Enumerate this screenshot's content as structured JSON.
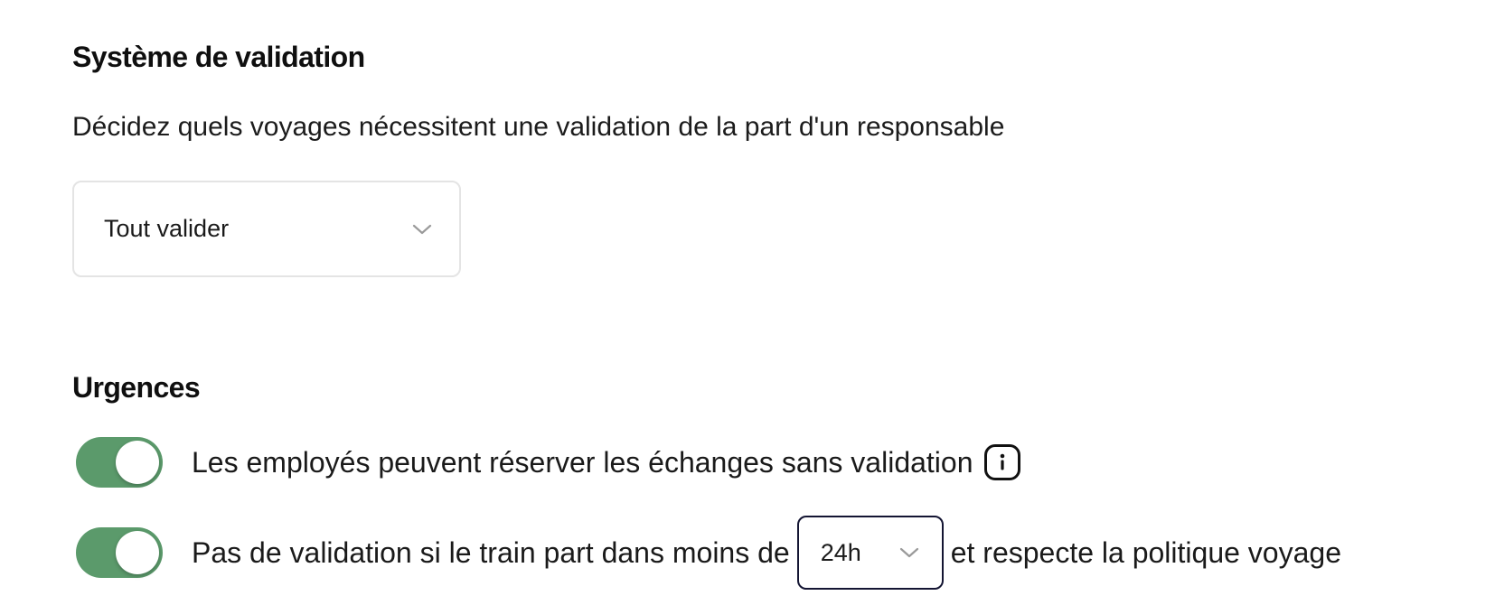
{
  "validation": {
    "title": "Système de validation",
    "description": "Décidez quels voyages nécessitent une validation de la part d'un responsable",
    "select_value": "Tout valider",
    "select_icon": "chevron-down-icon"
  },
  "urgences": {
    "title": "Urgences",
    "rows": [
      {
        "toggle_on": true,
        "text": "Les employés peuvent réserver les échanges sans validation",
        "info_icon": "info-icon"
      },
      {
        "toggle_on": true,
        "text_before": "Pas de validation si le train part dans moins de",
        "select_value": "24h",
        "text_after": "et respecte la politique voyage"
      }
    ]
  },
  "colors": {
    "toggle_on": "#5b9a6b",
    "focus_border": "#141533",
    "border": "#e4e4e4"
  }
}
